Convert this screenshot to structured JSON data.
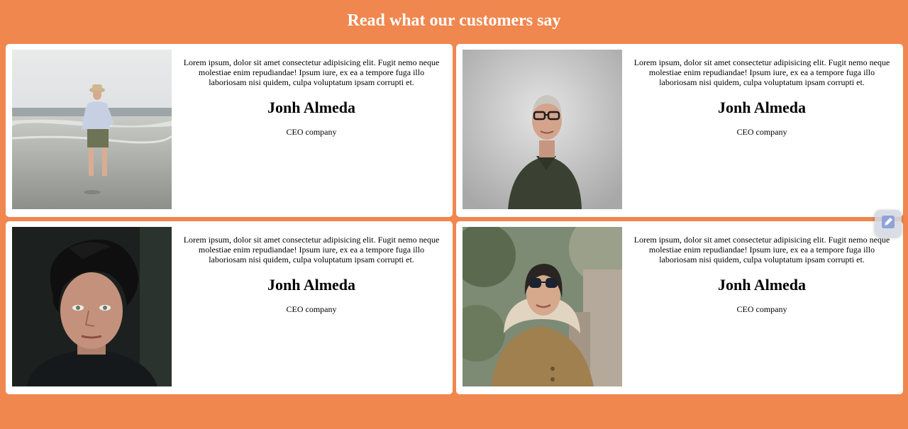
{
  "page": {
    "title": "Read what our customers say"
  },
  "testimonials": [
    {
      "quote": "Lorem ipsum, dolor sit amet consectetur adipisicing elit. Fugit nemo neque molestiae enim repudiandae! Ipsum iure, ex ea a tempore fuga illo laboriosam nisi quidem, culpa voluptatum ipsam corrupti et.",
      "name": "Jonh Almeda",
      "role": "CEO company"
    },
    {
      "quote": "Lorem ipsum, dolor sit amet consectetur adipisicing elit. Fugit nemo neque molestiae enim repudiandae! Ipsum iure, ex ea a tempore fuga illo laboriosam nisi quidem, culpa voluptatum ipsam corrupti et.",
      "name": "Jonh Almeda",
      "role": "CEO company"
    },
    {
      "quote": "Lorem ipsum, dolor sit amet consectetur adipisicing elit. Fugit nemo neque molestiae enim repudiandae! Ipsum iure, ex ea a tempore fuga illo laboriosam nisi quidem, culpa voluptatum ipsam corrupti et.",
      "name": "Jonh Almeda",
      "role": "CEO company"
    },
    {
      "quote": "Lorem ipsum, dolor sit amet consectetur adipisicing elit. Fugit nemo neque molestiae enim repudiandae! Ipsum iure, ex ea a tempore fuga illo laboriosam nisi quidem, culpa voluptatum ipsam corrupti et.",
      "name": "Jonh Almeda",
      "role": "CEO company"
    }
  ],
  "colors": {
    "background": "#f0874f",
    "card": "#ffffff",
    "title_text": "#ffffff"
  },
  "icons": {
    "floating_button": "edit-pencil-icon"
  }
}
